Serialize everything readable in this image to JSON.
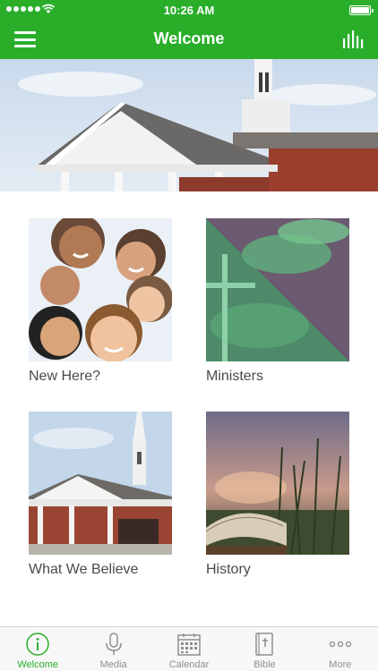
{
  "status_bar": {
    "time": "10:26 AM"
  },
  "nav": {
    "title": "Welcome"
  },
  "tiles": [
    {
      "label": "New Here?"
    },
    {
      "label": "Ministers"
    },
    {
      "label": "What We Believe"
    },
    {
      "label": "History"
    }
  ],
  "tabs": [
    {
      "label": "Welcome",
      "icon": "info-icon",
      "active": true
    },
    {
      "label": "Media",
      "icon": "microphone-icon",
      "active": false
    },
    {
      "label": "Calendar",
      "icon": "calendar-icon",
      "active": false
    },
    {
      "label": "Bible",
      "icon": "bible-icon",
      "active": false
    },
    {
      "label": "More",
      "icon": "more-icon",
      "active": false
    }
  ],
  "colors": {
    "brand": "#2aae2a",
    "tab_inactive": "#8e8e8e"
  }
}
